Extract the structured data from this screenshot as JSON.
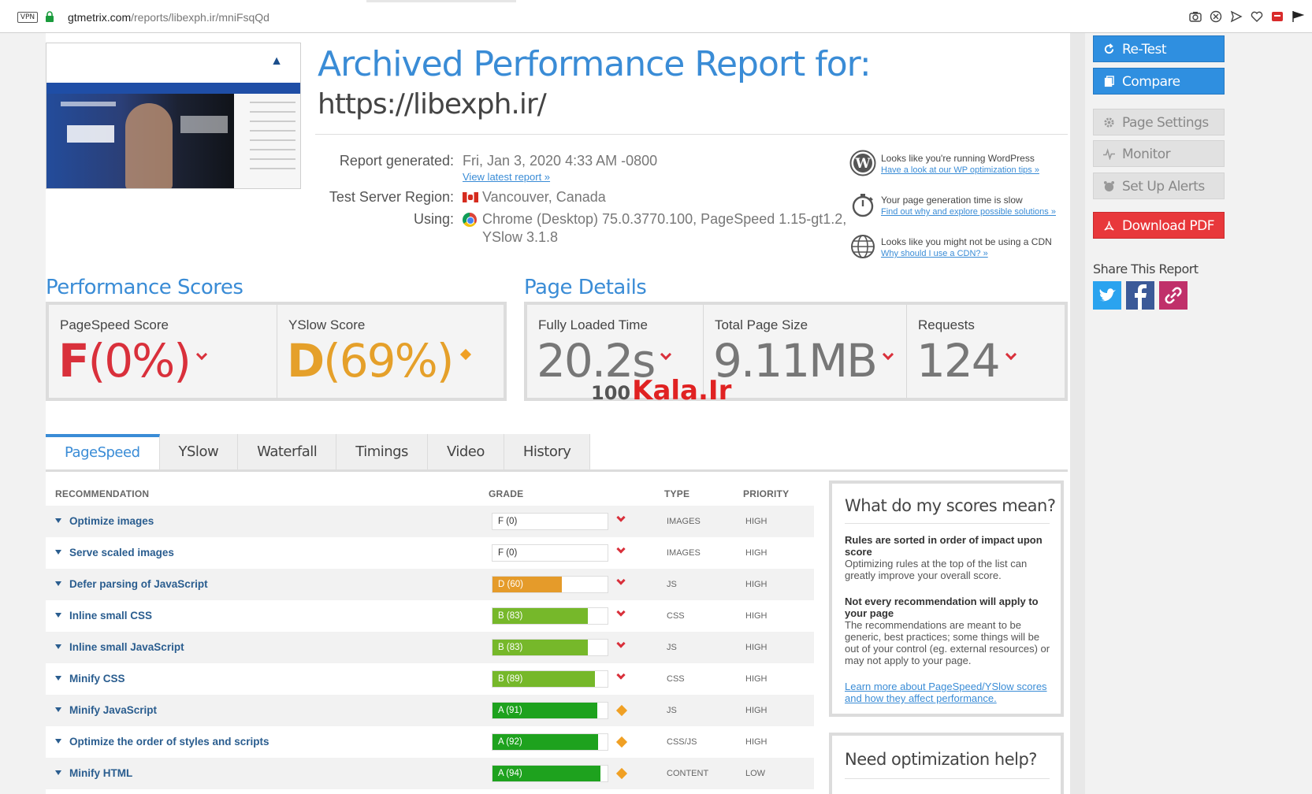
{
  "browser": {
    "vpn": "VPN",
    "url_host": "gtmetrix.com",
    "url_path": "/reports/libexph.ir/mniFsqQd"
  },
  "report": {
    "title": "Archived Performance Report for:",
    "url": "https://libexph.ir/",
    "generated_label": "Report generated:",
    "generated_value": "Fri, Jan 3, 2020 4:33 AM -0800",
    "latest_link": "View latest report »",
    "region_label": "Test Server Region:",
    "region_value": "Vancouver, Canada",
    "using_label": "Using:",
    "using_line1": "Chrome (Desktop) 75.0.3770.100, PageSpeed 1.15-gt1.2,",
    "using_line2": "YSlow 3.1.8"
  },
  "tips": [
    {
      "text": "Looks like you're running WordPress",
      "link": "Have a look at our WP optimization tips »",
      "icon": "wordpress-icon"
    },
    {
      "text": "Your page generation time is slow",
      "link": "Find out why and explore possible solutions »",
      "icon": "stopwatch-icon"
    },
    {
      "text": "Looks like you might not be using a CDN",
      "link": "Why should I use a CDN? »",
      "icon": "globe-icon"
    }
  ],
  "scores": {
    "heading": "Performance Scores",
    "pagespeed_label": "PageSpeed Score",
    "pagespeed_grade": "F",
    "pagespeed_pct": "(0%)",
    "yslow_label": "YSlow Score",
    "yslow_grade": "D",
    "yslow_pct": "(69%)"
  },
  "details": {
    "heading": "Page Details",
    "load_label": "Fully Loaded Time",
    "load_value": "20.2s",
    "size_label": "Total Page Size",
    "size_value": "9.11MB",
    "req_label": "Requests",
    "req_value": "124"
  },
  "watermark": {
    "pre": "100",
    "text": "Kala.Ir"
  },
  "tabs": [
    "PageSpeed",
    "YSlow",
    "Waterfall",
    "Timings",
    "Video",
    "History"
  ],
  "table": {
    "col_rec": "RECOMMENDATION",
    "col_grade": "GRADE",
    "col_type": "TYPE",
    "col_prio": "PRIORITY",
    "rows": [
      {
        "name": "Optimize images",
        "grade": "F (0)",
        "pct": 0,
        "color": "#ffffff",
        "trend": "down",
        "type": "IMAGES",
        "prio": "HIGH"
      },
      {
        "name": "Serve scaled images",
        "grade": "F (0)",
        "pct": 0,
        "color": "#ffffff",
        "trend": "down",
        "type": "IMAGES",
        "prio": "HIGH"
      },
      {
        "name": "Defer parsing of JavaScript",
        "grade": "D (60)",
        "pct": 60,
        "color": "#e59b2a",
        "trend": "down",
        "type": "JS",
        "prio": "HIGH"
      },
      {
        "name": "Inline small CSS",
        "grade": "B (83)",
        "pct": 83,
        "color": "#76b82a",
        "trend": "down",
        "type": "CSS",
        "prio": "HIGH"
      },
      {
        "name": "Inline small JavaScript",
        "grade": "B (83)",
        "pct": 83,
        "color": "#76b82a",
        "trend": "down",
        "type": "JS",
        "prio": "HIGH"
      },
      {
        "name": "Minify CSS",
        "grade": "B (89)",
        "pct": 89,
        "color": "#76b82a",
        "trend": "down",
        "type": "CSS",
        "prio": "HIGH"
      },
      {
        "name": "Minify JavaScript",
        "grade": "A (91)",
        "pct": 91,
        "color": "#1ea21e",
        "trend": "same",
        "type": "JS",
        "prio": "HIGH"
      },
      {
        "name": "Optimize the order of styles and scripts",
        "grade": "A (92)",
        "pct": 92,
        "color": "#1ea21e",
        "trend": "same",
        "type": "CSS/JS",
        "prio": "HIGH"
      },
      {
        "name": "Minify HTML",
        "grade": "A (94)",
        "pct": 94,
        "color": "#1ea21e",
        "trend": "same",
        "type": "CONTENT",
        "prio": "LOW"
      }
    ]
  },
  "info": {
    "heading": "What do my scores mean?",
    "p1_title": "Rules are sorted in order of impact upon score",
    "p1_text": "Optimizing rules at the top of the list can greatly improve your overall score.",
    "p2_title": "Not every recommendation will apply to your page",
    "p2_text": "The recommendations are meant to be generic, best practices; some things will be out of your control (eg. external resources) or may not apply to your page.",
    "link": "Learn more about PageSpeed/YSlow scores and how they affect performance."
  },
  "help": {
    "heading": "Need optimization help?"
  },
  "sidebar": {
    "retest": "Re-Test",
    "compare": "Compare",
    "page_settings": "Page Settings",
    "monitor": "Monitor",
    "alerts": "Set Up Alerts",
    "pdf": "Download PDF",
    "share": "Share This Report"
  },
  "colors": {
    "accent": "#3a8cd6",
    "grade_f": "#d9303b",
    "grade_d": "#e5a02a",
    "pdf": "#e8383b"
  }
}
